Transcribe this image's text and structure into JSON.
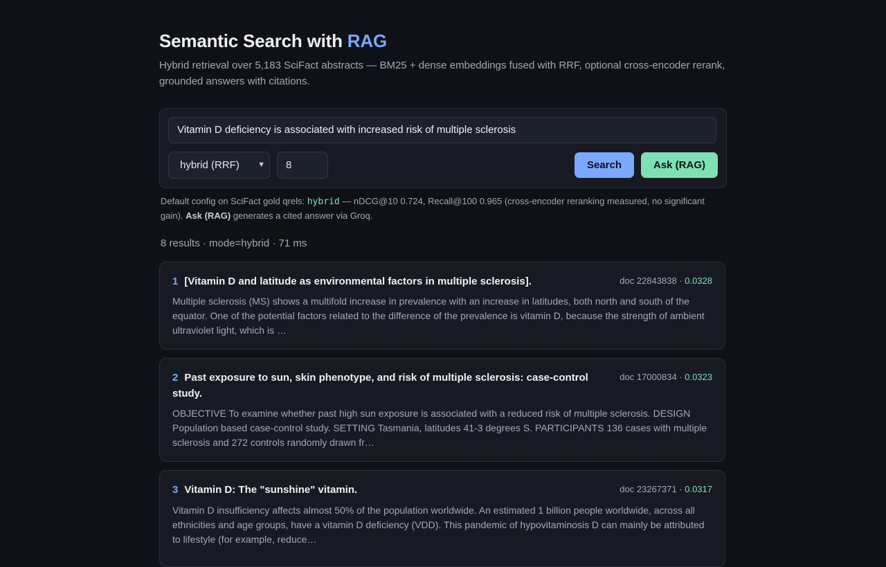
{
  "header": {
    "title": "Semantic Search with ",
    "title_accent": "RAG",
    "subtitle": "Hybrid retrieval over 5,183 SciFact abstracts — BM25 + dense embeddings fused with RRF, optional cross-encoder rerank, grounded answers with citations."
  },
  "search": {
    "query": "Vitamin D deficiency is associated with increased risk of multiple sclerosis",
    "mode": "hybrid (RRF)",
    "top_k": "8",
    "search_label": "Search",
    "ask_label": "Ask (RAG)"
  },
  "note": {
    "prefix": "Default config on SciFact gold qrels: ",
    "code": "hybrid",
    "middle": " — nDCG@10 0.724, Recall@100 0.965 (cross-encoder reranking measured, no significant gain). ",
    "bold": "Ask (RAG)",
    "suffix": " generates a cited answer via Groq."
  },
  "results_meta": "8 results · mode=hybrid · 71 ms",
  "results": [
    {
      "rank": "1",
      "title": "[Vitamin D and latitude as environmental factors in multiple sclerosis].",
      "doc": "doc 22843838 · ",
      "score": "0.0328",
      "snippet": "Multiple sclerosis (MS) shows a multifold increase in prevalence with an increase in latitudes, both north and south of the equator. One of the potential factors related to the difference of the prevalence is vitamin D, because the strength of ambient ultraviolet light, which is …"
    },
    {
      "rank": "2",
      "title": "Past exposure to sun, skin phenotype, and risk of multiple sclerosis: case-control study.",
      "doc": "doc 17000834 · ",
      "score": "0.0323",
      "snippet": "OBJECTIVE To examine whether past high sun exposure is associated with a reduced risk of multiple sclerosis. DESIGN Population based case-control study. SETTING Tasmania, latitudes 41-3 degrees S. PARTICIPANTS 136 cases with multiple sclerosis and 272 controls randomly drawn fr…"
    },
    {
      "rank": "3",
      "title": "Vitamin D: The \"sunshine\" vitamin.",
      "doc": "doc 23267371 · ",
      "score": "0.0317",
      "snippet": "Vitamin D insufficiency affects almost 50% of the population worldwide. An estimated 1 billion people worldwide, across all ethnicities and age groups, have a vitamin D deficiency (VDD). This pandemic of hypovitaminosis D can mainly be attributed to lifestyle (for example, reduce…"
    }
  ]
}
